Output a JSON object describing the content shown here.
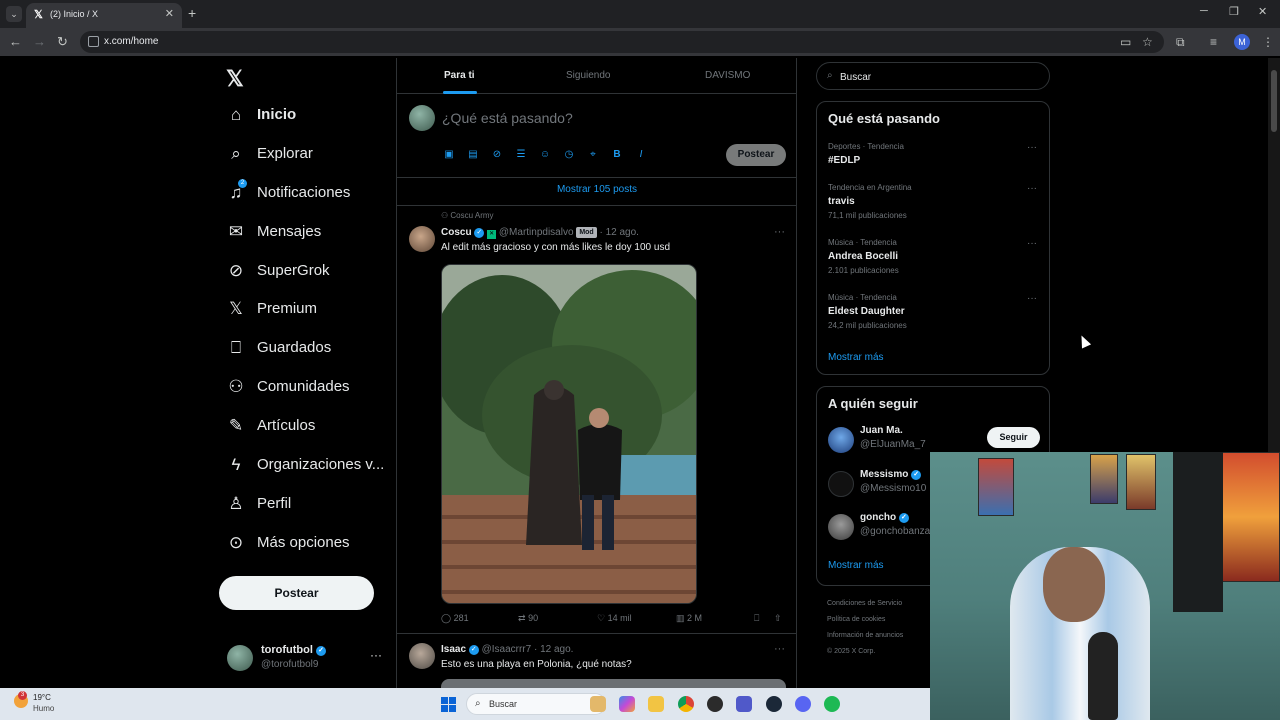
{
  "browser": {
    "tab_title": "(2) Inicio / X",
    "url": "x.com/home",
    "profile_initial": "M"
  },
  "nav": {
    "items": [
      {
        "label": "Inicio",
        "icon": "home-icon"
      },
      {
        "label": "Explorar",
        "icon": "search-icon"
      },
      {
        "label": "Notificaciones",
        "icon": "bell-icon"
      },
      {
        "label": "Mensajes",
        "icon": "mail-icon"
      },
      {
        "label": "SuperGrok",
        "icon": "grok-icon"
      },
      {
        "label": "Premium",
        "icon": "x-icon"
      },
      {
        "label": "Guardados",
        "icon": "bookmark-icon"
      },
      {
        "label": "Comunidades",
        "icon": "people-icon"
      },
      {
        "label": "Artículos",
        "icon": "article-icon"
      },
      {
        "label": "Organizaciones v...",
        "icon": "lightning-icon"
      },
      {
        "label": "Perfil",
        "icon": "person-icon"
      },
      {
        "label": "Más opciones",
        "icon": "more-circle-icon"
      }
    ],
    "notif_badge": "2",
    "post_button": "Postear",
    "account": {
      "name": "torofutbol",
      "handle": "@torofutbol9"
    }
  },
  "main": {
    "tabs": [
      "Para ti",
      "Siguiendo",
      "DAVISMO"
    ],
    "composer_placeholder": "¿Qué está pasando?",
    "composer_post": "Postear",
    "show_posts": "Mostrar 105 posts",
    "tweets": [
      {
        "social_context": "Coscu Army",
        "name": "Coscu",
        "handle": "@Martinpdisalvo",
        "badge": "Mod",
        "time": "· 12 ago.",
        "text": "Al edit más gracioso y con más likes le doy 100 usd",
        "replies": "281",
        "retweets": "90",
        "likes": "14 mil",
        "views": "2 M"
      },
      {
        "name": "Isaac",
        "handle": "@Isaacrrr7",
        "time": "· 12 ago.",
        "text": "Esto es una playa en Polonia, ¿qué notas?"
      }
    ]
  },
  "right": {
    "search_placeholder": "Buscar",
    "trends_title": "Qué está pasando",
    "trends": [
      {
        "meta": "Deportes · Tendencia",
        "name": "#EDLP",
        "count": ""
      },
      {
        "meta": "Tendencia en Argentina",
        "name": "travis",
        "count": "71,1 mil publicaciones"
      },
      {
        "meta": "Música · Tendencia",
        "name": "Andrea Bocelli",
        "count": "2.101 publicaciones"
      },
      {
        "meta": "Música · Tendencia",
        "name": "Eldest Daughter",
        "count": "24,2 mil publicaciones"
      }
    ],
    "trends_more": "Mostrar más",
    "follow_title": "A quién seguir",
    "follow": [
      {
        "name": "Juan Ma.",
        "handle": "@ElJuanMa_7"
      },
      {
        "name": "Messismo",
        "handle": "@Messismo10"
      },
      {
        "name": "goncho",
        "handle": "@gonchobanza"
      }
    ],
    "follow_button": "Seguir",
    "follow_more": "Mostrar más",
    "footer": [
      "Condiciones de Servicio",
      "Política de cookies",
      "Información de anuncios",
      "© 2025 X Corp."
    ]
  },
  "taskbar": {
    "weather_badge": "3",
    "temp": "19°C",
    "condition": "Humo",
    "search": "Buscar"
  }
}
